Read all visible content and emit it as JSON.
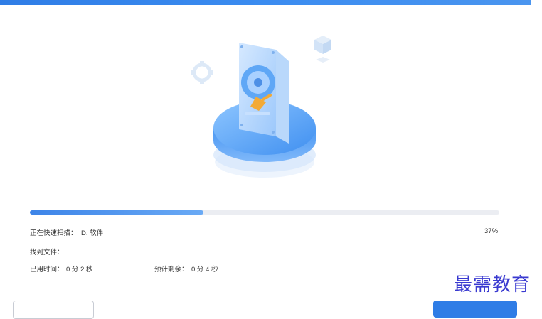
{
  "window": {
    "title": ""
  },
  "scan": {
    "status_label": "正在快速扫描：",
    "current_target": "D: 软件",
    "progress": 0.37,
    "progress_text": "37%",
    "found_files_label": "找到文件：",
    "found_files_value": "",
    "elapsed_label": "已用时间：",
    "elapsed_value": "0 分 2 秒",
    "remaining_label": "预计剩余：",
    "remaining_value": "0 分 4 秒"
  },
  "watermark": "最需教育",
  "colors": {
    "accent": "#2f7de6",
    "track": "#ebedf2",
    "watermark": "#3a3ad0"
  },
  "icons": [
    "hard-drive-icon",
    "gear-icon",
    "cube-icon"
  ]
}
